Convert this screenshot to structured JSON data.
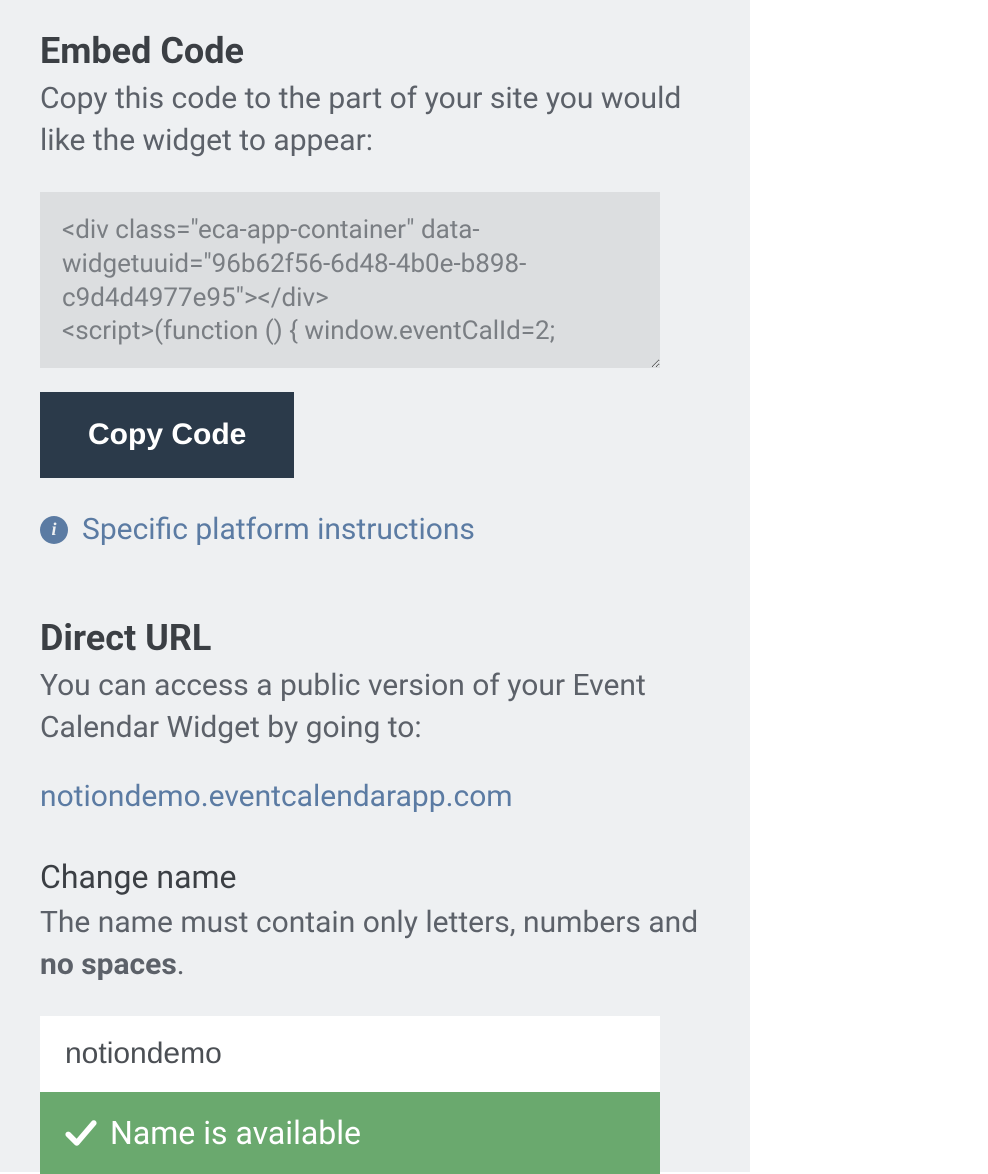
{
  "embed": {
    "title": "Embed Code",
    "description": "Copy this code to the part of your site you would like the widget to appear:",
    "code": "<div class=\"eca-app-container\" data-widgetuuid=\"96b62f56-6d48-4b0e-b898-c9d4d4977e95\"></div>\n<script>(function () { window.eventCalId=2;",
    "copy_button": "Copy Code",
    "platform_link": "Specific platform instructions"
  },
  "direct_url": {
    "title": "Direct URL",
    "description": "You can access a public version of your Event Calendar Widget by going to:",
    "url": "notiondemo.eventcalendarapp.com"
  },
  "change_name": {
    "title": "Change name",
    "desc_prefix": "The name must contain only letters, numbers and ",
    "desc_bold": "no spaces",
    "desc_suffix": ".",
    "input_value": "notiondemo",
    "available_text": "Name is available"
  }
}
